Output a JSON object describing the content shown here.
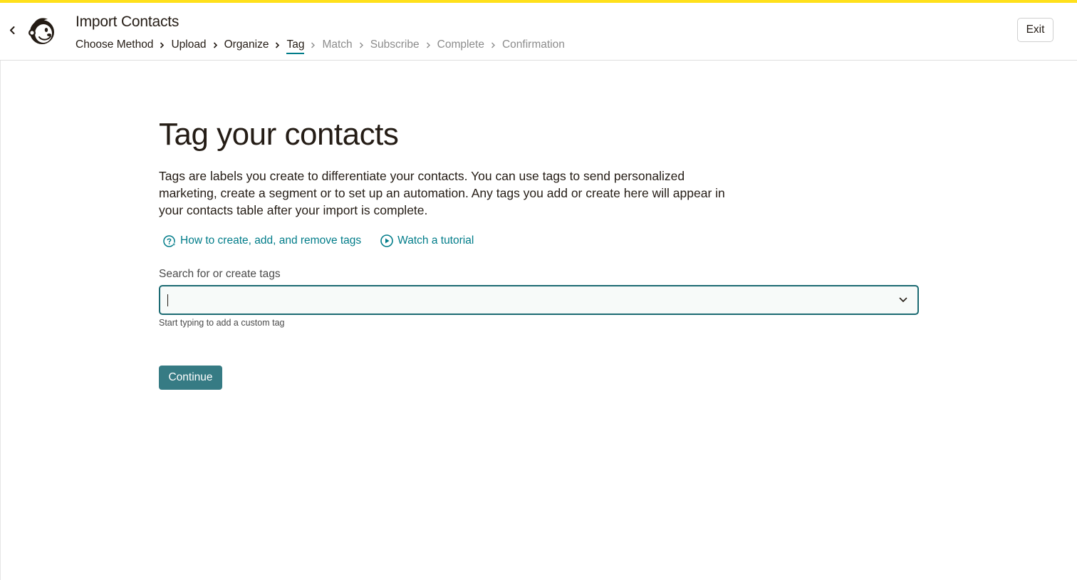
{
  "colors": {
    "accent_bar": "#ffe01b",
    "link": "#007c89",
    "button": "#367b84",
    "input_border": "#1b6a72"
  },
  "header": {
    "title": "Import Contacts",
    "back_icon": "chevron-left-icon",
    "logo_icon": "mailchimp-freddie-logo",
    "exit_label": "Exit",
    "steps": [
      {
        "label": "Choose Method",
        "state": "done"
      },
      {
        "label": "Upload",
        "state": "done"
      },
      {
        "label": "Organize",
        "state": "done"
      },
      {
        "label": "Tag",
        "state": "active"
      },
      {
        "label": "Match",
        "state": "future"
      },
      {
        "label": "Subscribe",
        "state": "future"
      },
      {
        "label": "Complete",
        "state": "future"
      },
      {
        "label": "Confirmation",
        "state": "future"
      }
    ]
  },
  "main": {
    "title": "Tag your contacts",
    "intro": "Tags are labels you create to differentiate your contacts. You can use tags to send personalized marketing, create a segment or to set up an automation. Any tags you add or create here will appear in your contacts table after your import is complete.",
    "links": {
      "help": {
        "label": "How to create, add, and remove tags",
        "icon": "help-sparkle-icon"
      },
      "tutorial": {
        "label": "Watch a tutorial",
        "icon": "play-circle-icon"
      }
    },
    "tag_field": {
      "label": "Search for or create tags",
      "value": "",
      "placeholder": "",
      "hint": "Start typing to add a custom tag",
      "dropdown_icon": "chevron-down-icon"
    },
    "continue_label": "Continue"
  }
}
